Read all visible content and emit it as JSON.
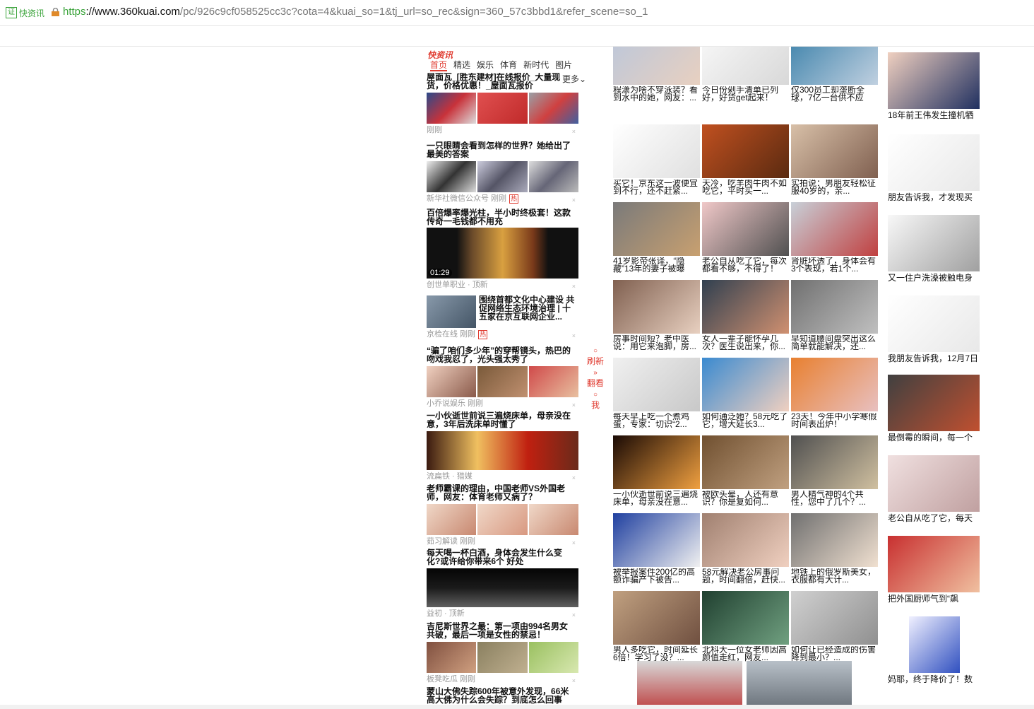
{
  "addressbar": {
    "cert_icon": "证",
    "cert_label": "快资讯",
    "url_scheme": "https",
    "url_host": "://www.360kuai.com",
    "url_path": "/pc/926c9cf058525cc3c?cota=4&kuai_so=1&tj_url=so_rec&sign=360_57c3bbd1&refer_scene=so_1"
  },
  "feed": {
    "logo": "快资讯",
    "tabs": [
      "首页",
      "精选",
      "娱乐",
      "体育",
      "新时代",
      "图片"
    ],
    "more_label": "更多",
    "items": [
      {
        "title": "屋面瓦_[胜东建材]在线报价_大量现货，价格优惠！_屋面瓦报价",
        "meta": "刚刚"
      },
      {
        "title": "一只眼睛会看到怎样的世界？她给出了最美的答案",
        "meta": "新华社微信公众号  刚刚",
        "hot": "热"
      },
      {
        "title": "百倍爆率爆光柱，半小时终极套！这款传奇一毛钱都不用充",
        "meta": "创世单职业 · 顶新",
        "video_time": "01:29"
      },
      {
        "title": "围绕首都文化中心建设 共促网络生态环境治理 | 十五家在京互联网企业...",
        "meta": "京检在线  刚刚",
        "hot": "热"
      },
      {
        "title": "“骗了咱们多少年”的穿帮镜头，热巴的吻戏我忍了，光头强太秀了",
        "meta": "小乔说娱乐  刚刚"
      },
      {
        "title": "一小伙逝世前说三遍烧床单，母亲没在意，3年后洗床单时懂了",
        "meta": "流扁铁 · 猎媒"
      },
      {
        "title": "老师霸课的理由，中国老师VS外国老师，网友：体育老师又病了？",
        "meta": "茹习解读  刚刚"
      },
      {
        "title": "每天喝一杯白酒，身体会发生什么变化?或许给你带来6个 好处",
        "meta": "益初 · 顶新"
      },
      {
        "title": "吉尼斯世界之最：第一项由994名男女共破，最后一项是女性的禁忌！",
        "meta": "板凳吃瓜  刚刚"
      },
      {
        "title": "蒙山大佛失踪600年被意外发现，66米高大佛为什么会失踪？到底怎么回事",
        "meta": ""
      }
    ]
  },
  "refresh": {
    "refresh_label": "刷新",
    "look_label": "翻看",
    "me_label": "我"
  },
  "grid": [
    {
      "cap": "程潇为啥不穿泳装？看到水中的她，网友：..."
    },
    {
      "cap": "今日份剁手清单已列好，好货get起来！"
    },
    {
      "cap": "仅300员工却垄断全球，7亿一台供不应求..."
    },
    {
      "cap": "买它！京东这一波便宜到不行，还不赶紧..."
    },
    {
      "cap": "天冷，吃羊肉牛肉不如吃它，平时买一..."
    },
    {
      "cap": "实拍说：男朋友轻松征服40岁的，亲..."
    },
    {
      "cap": "41岁影帝张译，“隐藏”13年的妻子被曝光..."
    },
    {
      "cap": "老公自从吃了它，每次都看不够，不得了！"
    },
    {
      "cap": "肾脏坏透了，身体会有3个表现，若1个..."
    },
    {
      "cap": "房事时间短？老中医说：用它来泡脚，房..."
    },
    {
      "cap": "女人一辈子能怀孕几次？医生说出来，你..."
    },
    {
      "cap": "早知道腰间盘突出这么简单就能解决，还..."
    },
    {
      "cap": "每天早上吃一个煮鸡蛋，专家：切识“2..."
    },
    {
      "cap": "如何通泛她？58元吃了它，增大延长3..."
    },
    {
      "cap": "23天！今年中小学寒假时间表出炉！"
    },
    {
      "cap": "一小伙逝世前说三遍烧床单，母亲没在意..."
    },
    {
      "cap": "被欧头晕，人还有意识？你是复如何..."
    },
    {
      "cap": "男人精气神的4个共性，您中了几个？..."
    },
    {
      "cap": "被举报案件200亿的高额诈骗产下被告..."
    },
    {
      "cap": "58元解决老公房事问题，时间翻倍，赶快..."
    },
    {
      "cap": "地铁上的俄罗斯美女，衣服都有大计..."
    },
    {
      "cap": "男人多吃它，时间延长6倍！学习了没？..."
    },
    {
      "cap": "北科大一位女老师因高颜值走红，网友..."
    },
    {
      "cap": "如何让已经造成的伤害降到最小？..."
    }
  ],
  "right": [
    {
      "cap": "18年前王伟发生撞机牺"
    },
    {
      "cap": "朋友告诉我，才发现买"
    },
    {
      "cap": "又一住户洗澡被触电身"
    },
    {
      "cap": "我朋友告诉我，12月7日"
    },
    {
      "cap": "最倒霉的瞬间，每一个"
    },
    {
      "cap": "老公自从吃了它，每天"
    },
    {
      "cap": "把外国厨师气到“飙"
    },
    {
      "cap": "妈耶，终于降价了！数"
    }
  ]
}
